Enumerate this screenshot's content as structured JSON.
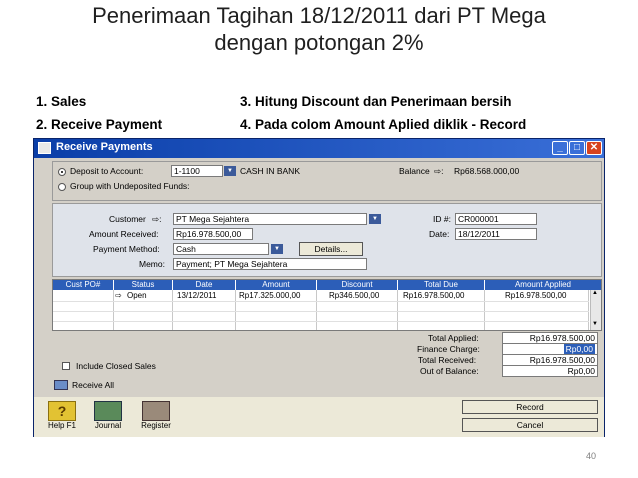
{
  "slide": {
    "title_line1": "Penerimaan Tagihan 18/12/2011 dari PT Mega",
    "title_line2": "dengan potongan 2%",
    "bullet1": "1.  Sales",
    "bullet2": "2.  Receive Payment",
    "bullet3": "3.  Hitung Discount dan Penerimaan  bersih",
    "bullet4": "4. Pada colom Amount  Aplied diklik - Record",
    "page_number": "40"
  },
  "window": {
    "title": "Receive Payments",
    "deposit_option": "Deposit to Account:",
    "deposit_account": "1-1100",
    "account_name": "CASH IN BANK",
    "group_option": "Group with Undeposited Funds:",
    "balance_label": "Balance",
    "balance_value": "Rp68.568.000,00",
    "customer_label": "Customer",
    "customer_value": "PT Mega Sejahtera",
    "amount_label": "Amount Received:",
    "amount_value": "Rp16.978.500,00",
    "method_label": "Payment Method:",
    "method_value": "Cash",
    "details_button": "Details...",
    "memo_label": "Memo:",
    "memo_value": "Payment; PT Mega Sejahtera",
    "id_label": "ID #:",
    "id_value": "CR000001",
    "date_label": "Date:",
    "date_value": "18/12/2011"
  },
  "grid": {
    "headers": [
      "Cust PO#",
      "Status",
      "Date",
      "Amount",
      "Discount",
      "Total Due",
      "Amount Applied"
    ],
    "row": {
      "po": "",
      "status": "Open",
      "date": "13/12/2011",
      "amount": "Rp17.325.000,00",
      "discount": "Rp346.500,00",
      "total_due": "Rp16.978.500,00",
      "applied": "Rp16.978.500,00"
    }
  },
  "summary": {
    "total_applied_label": "Total Applied:",
    "total_applied": "Rp16.978.500,00",
    "finance_charge_label": "Finance Charge:",
    "finance_charge": "Rp0,00",
    "total_received_label": "Total Received:",
    "total_received": "Rp16.978.500,00",
    "out_of_balance_label": "Out of Balance:",
    "out_of_balance": "Rp0,00"
  },
  "controls": {
    "include_closed": "Include Closed Sales",
    "receive_all": "Receive All",
    "record": "Record",
    "cancel": "Cancel"
  },
  "toolbar": {
    "help": "Help F1",
    "journal": "Journal",
    "register": "Register"
  },
  "colors": {
    "titlebar": "#0a3ea8",
    "grid_header": "#2c5eb8",
    "window_bg": "#d4d0c8"
  }
}
